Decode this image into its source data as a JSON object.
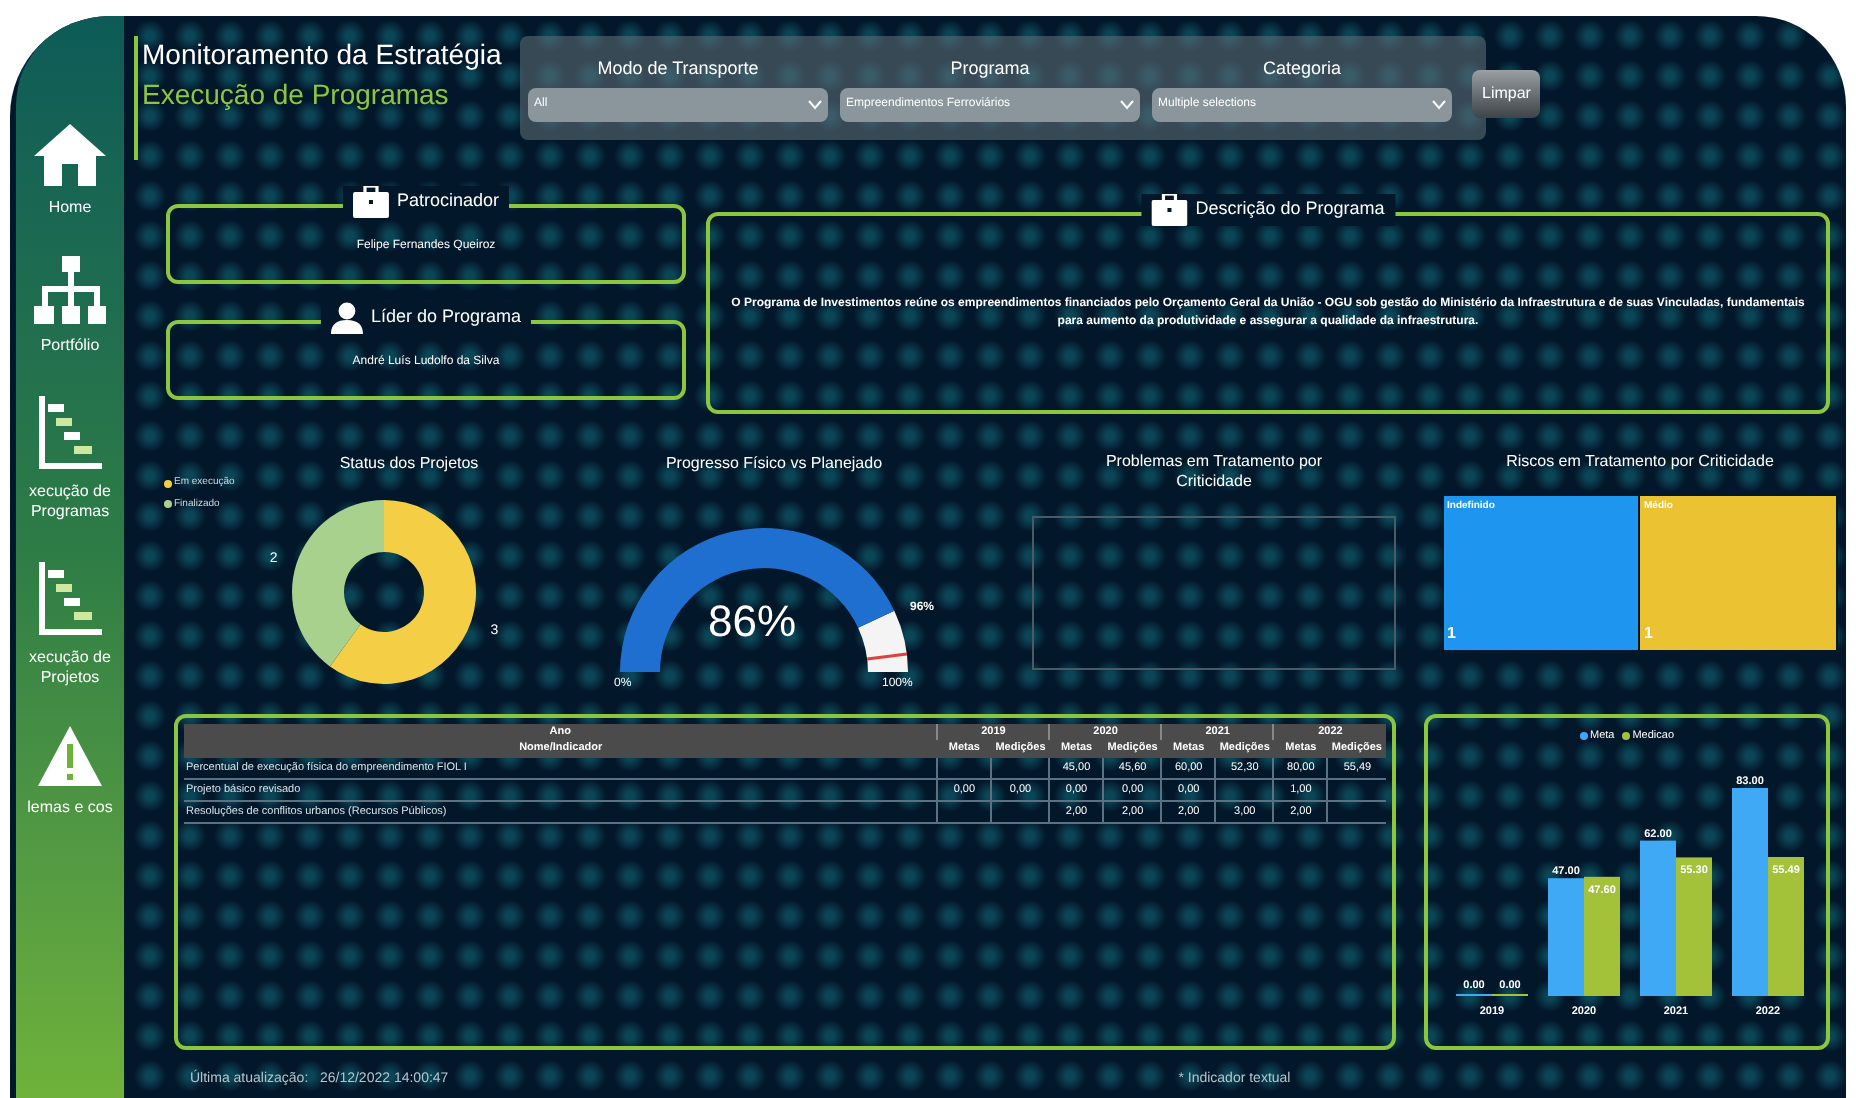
{
  "sidebar": {
    "items": [
      {
        "label": "Home"
      },
      {
        "label": "Portfólio"
      },
      {
        "label": "xecução de Programas"
      },
      {
        "label": "xecução de Projetos"
      },
      {
        "label": "lemas e cos"
      }
    ]
  },
  "header": {
    "title": "Monitoramento da Estratégia",
    "subtitle": "Execução de Programas"
  },
  "filters": [
    {
      "label": "Modo de Transporte",
      "value": "All"
    },
    {
      "label": "Programa",
      "value": "Empreendimentos Ferroviários"
    },
    {
      "label": "Categoria",
      "value": "Multiple selections"
    }
  ],
  "clear_button": "Limpar",
  "cards": [
    {
      "title": "Patrocinador",
      "text": "Felipe Fernandes Queiroz"
    },
    {
      "title": "Líder do Programa",
      "text": "André Luís Ludolfo da Silva"
    }
  ],
  "description": {
    "title": "Descrição do Programa",
    "text": "O Programa de Investimentos reúne os empreendimentos financiados pelo Orçamento Geral da União - OGU sob gestão do Ministério da Infraestrutura e de suas Vinculadas, fundamentais para aumento da produtividade e assegurar a qualidade da infraestrutura."
  },
  "status": {
    "legend": [
      {
        "color": "#f4cf46"
      },
      {
        "color": "#a9d18e"
      }
    ],
    "chart_data": {
      "type": "donut",
      "title": "Status dos Projetos",
      "categories": [
        "Em execução",
        "Finalizado"
      ],
      "series": [
        {
          "values": [
            3,
            2
          ]
        }
      ],
      "data_labels": true
    }
  },
  "progress": {
    "title": "Progresso Físico vs Planejado",
    "value_label": "86%",
    "target_label": "96%",
    "min_label": "0%",
    "max_label": "100%"
  },
  "problems": {
    "title": "Problemas em Tratamento por Criticidade"
  },
  "risks": {
    "title": "Riscos em Tratamento por Criticidade",
    "cells": [
      {
        "label": "Indefinido",
        "value": "1",
        "color": "#1e96f0"
      },
      {
        "label": "Médio",
        "value": "1",
        "color": "#ebc232"
      }
    ]
  },
  "table": {
    "top_header": "Ano",
    "name_header": "Nome/Indicador",
    "years": [
      {
        "year": "2019",
        "columns": [
          "Metas",
          "Medições"
        ]
      },
      {
        "year": "2020",
        "columns": [
          "Metas",
          "Medições"
        ]
      },
      {
        "year": "2021",
        "columns": [
          "Metas",
          "Medições"
        ]
      },
      {
        "year": "2022",
        "columns": [
          "Metas",
          "Medições"
        ]
      }
    ],
    "rows": [
      {
        "name": "Percentual de execução física do empreendimento FIOL I",
        "cells": [
          null,
          null,
          "45,00",
          "45,60",
          "60,00",
          "52,30",
          "80,00",
          "55,49"
        ]
      },
      {
        "name": "Projeto básico revisado",
        "cells": [
          "0,00",
          "0,00",
          "0,00",
          "0,00",
          "0,00",
          null,
          "1,00",
          null
        ]
      },
      {
        "name": "Resoluções de conflitos urbanos (Recursos Públicos)",
        "cells": [
          null,
          null,
          "2,00",
          "2,00",
          "2,00",
          "3,00",
          "2,00",
          null
        ]
      }
    ]
  },
  "bars": {
    "chart_data": {
      "type": "bar",
      "categories": [
        "2019",
        "2020",
        "2021",
        "2022"
      ],
      "series": [
        {
          "name": "Meta",
          "color": "#3fa9f5",
          "values": [
            0,
            47,
            62,
            83
          ],
          "value_labels": [
            "0.00",
            "47.00",
            "62.00",
            "83.00"
          ]
        },
        {
          "name": "Medicao",
          "color": "#a3c23a",
          "values": [
            0,
            47.6,
            55.3,
            55.49
          ],
          "value_labels": [
            "0.00",
            "47.60",
            "55.30",
            "55.49"
          ]
        }
      ]
    }
  },
  "footer": {
    "updated": "Última atualização:   26/12/2022 14:00:47",
    "note": "* Indicador textual"
  }
}
